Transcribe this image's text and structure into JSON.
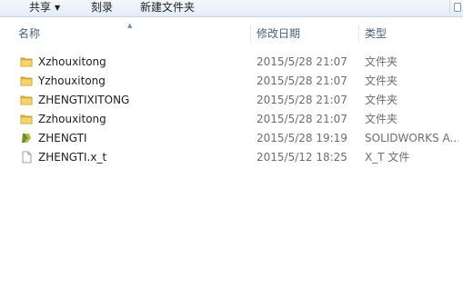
{
  "toolbar": {
    "share_label": "共享",
    "burn_label": "刻录",
    "new_folder_label": "新建文件夹"
  },
  "columns": {
    "name": "名称",
    "date": "修改日期",
    "type": "类型"
  },
  "files": [
    {
      "name": "Xzhouxitong",
      "date": "2015/5/28 21:07",
      "type": "文件夹",
      "icon": "folder-icon"
    },
    {
      "name": "Yzhouxitong",
      "date": "2015/5/28 21:07",
      "type": "文件夹",
      "icon": "folder-icon"
    },
    {
      "name": "ZHENGTIXITONG",
      "date": "2015/5/28 21:07",
      "type": "文件夹",
      "icon": "folder-icon"
    },
    {
      "name": "Zzhouxitong",
      "date": "2015/5/28 21:07",
      "type": "文件夹",
      "icon": "folder-icon"
    },
    {
      "name": "ZHENGTI",
      "date": "2015/5/28 19:19",
      "type": "SOLIDWORKS A...",
      "icon": "solidworks-file-icon"
    },
    {
      "name": "ZHENGTI.x_t",
      "date": "2015/5/12 18:25",
      "type": "X_T 文件",
      "icon": "document-file-icon"
    }
  ],
  "colors": {
    "folder": "#e8b83a",
    "toolbar_bg": "#e3ecf7",
    "header_text": "#4c607a",
    "meta_text": "#6d6d6d"
  }
}
